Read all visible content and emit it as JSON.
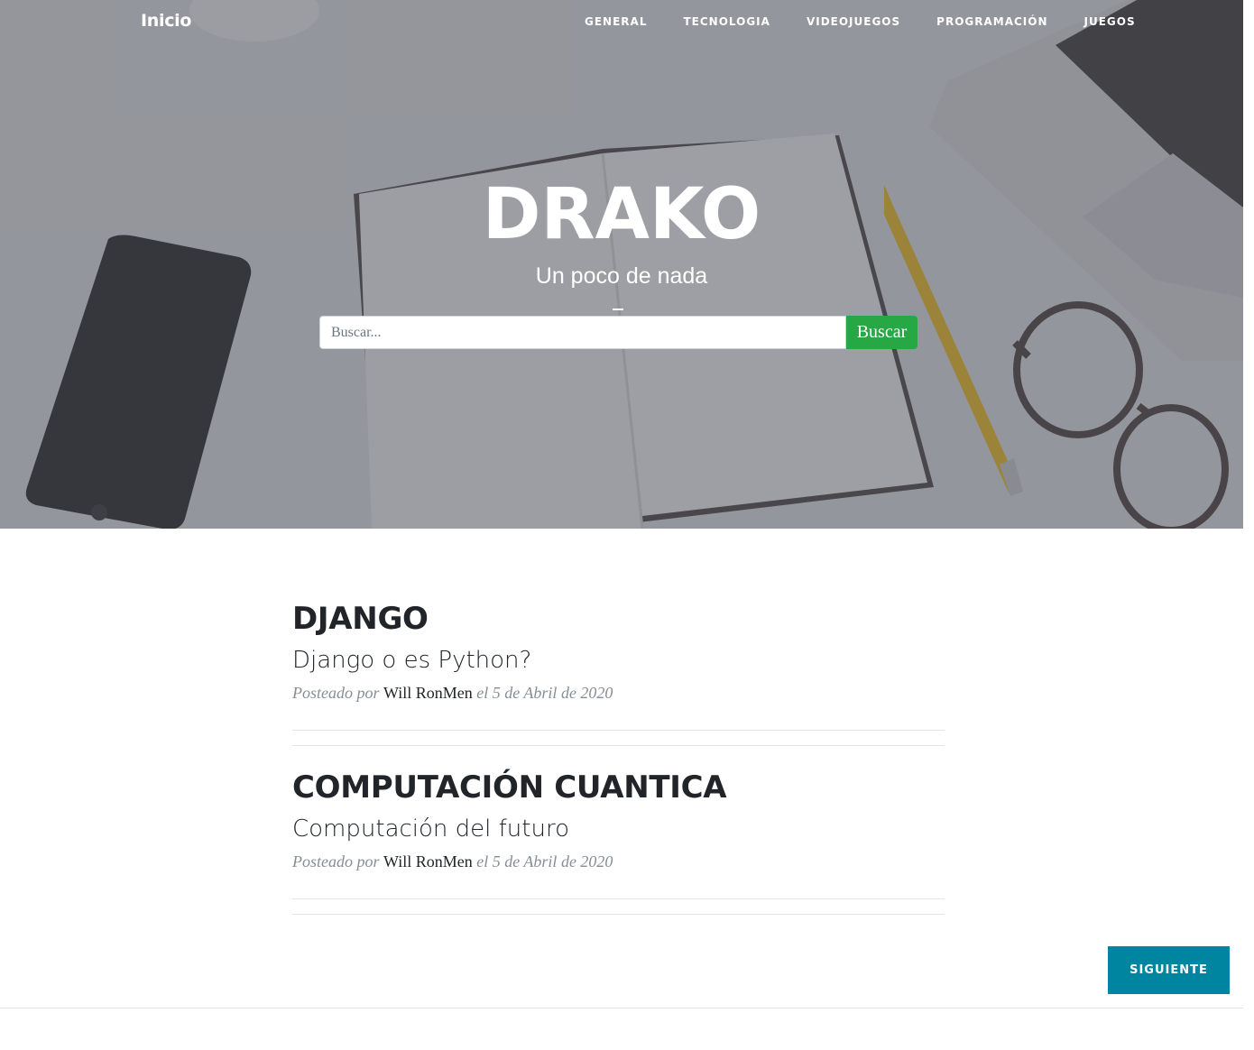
{
  "nav": {
    "brand": "Inicio",
    "links": [
      "GENERAL",
      "TECNOLOGIA",
      "VIDEOJUEGOS",
      "PROGRAMACIÓN",
      "JUEGOS"
    ]
  },
  "hero": {
    "title": "DRAKO",
    "subtitle": "Un poco de nada",
    "search": {
      "placeholder": "Buscar...",
      "button_label": "Buscar"
    }
  },
  "posts": [
    {
      "title": "DJANGO",
      "subtitle": "Django o es Python?",
      "meta_prefix": "Posteado por",
      "author": "Will RonMen",
      "meta_date": "el 5 de Abril de 2020"
    },
    {
      "title": "COMPUTACIÓN CUANTICA",
      "subtitle": "Computación del futuro",
      "meta_prefix": "Posteado por",
      "author": "Will RonMen",
      "meta_date": "el 5 de Abril de 2020"
    }
  ],
  "pagination": {
    "next_label": "SIGUIENTE"
  },
  "colors": {
    "search_button": "#28a745",
    "next_button": "#0085a1",
    "title_text": "#212529",
    "meta_text": "#868e96"
  }
}
